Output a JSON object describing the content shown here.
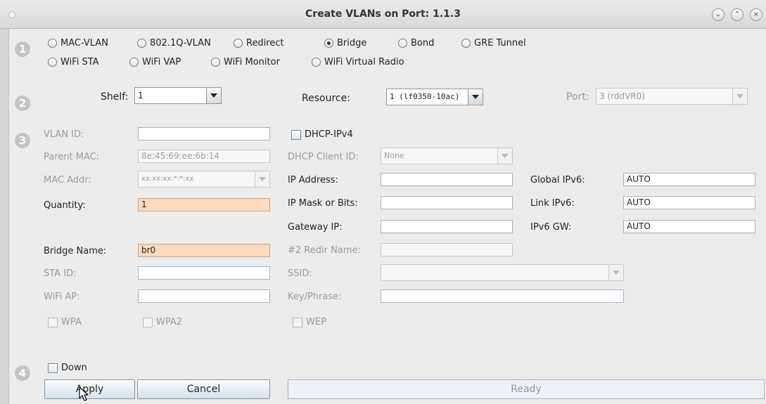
{
  "window": {
    "title": "Create VLANs on Port: 1.1.3"
  },
  "steps": [
    "1",
    "2",
    "3",
    "4"
  ],
  "vlan_types": {
    "row1": [
      {
        "label": "MAC-VLAN",
        "selected": false
      },
      {
        "label": "802.1Q-VLAN",
        "selected": false
      },
      {
        "label": "Redirect",
        "selected": false
      },
      {
        "label": "Bridge",
        "selected": true
      },
      {
        "label": "Bond",
        "selected": false
      },
      {
        "label": "GRE Tunnel",
        "selected": false
      }
    ],
    "row2": [
      {
        "label": "WiFi STA",
        "selected": false
      },
      {
        "label": "WiFi VAP",
        "selected": false
      },
      {
        "label": "WiFi Monitor",
        "selected": false
      },
      {
        "label": "WiFi Virtual Radio",
        "selected": false
      }
    ]
  },
  "location": {
    "shelf_label": "Shelf:",
    "shelf_value": "1",
    "resource_label": "Resource:",
    "resource_value": "1 (lf0350-10ac)",
    "port_label": "Port:",
    "port_value": "3 (rddVR0)"
  },
  "config": {
    "vlan_id_label": "VLAN ID:",
    "vlan_id_value": "",
    "parent_mac_label": "Parent MAC:",
    "parent_mac_value": "8e:45:69:ee:6b:14",
    "mac_addr_label": "MAC Addr:",
    "mac_addr_value": "xx:xx:xx:*:*:xx",
    "quantity_label": "Quantity:",
    "quantity_value": "1",
    "bridge_name_label": "Bridge Name:",
    "bridge_name_value": "br0",
    "sta_id_label": "STA ID:",
    "sta_id_value": "",
    "wifi_ap_label": "WiFi AP:",
    "wifi_ap_value": "",
    "wpa_label": "WPA",
    "wpa2_label": "WPA2",
    "dhcp_ipv4_label": "DHCP-IPv4",
    "dhcp_client_id_label": "DHCP Client ID:",
    "dhcp_client_id_value": "None",
    "ip_address_label": "IP Address:",
    "ip_address_value": "",
    "ip_mask_label": "IP Mask or Bits:",
    "ip_mask_value": "",
    "gateway_ip_label": "Gateway IP:",
    "gateway_ip_value": "",
    "redir_name_label": "#2 Redir Name:",
    "redir_name_value": "",
    "ssid_label": "SSID:",
    "ssid_value": "",
    "key_phrase_label": "Key/Phrase:",
    "key_phrase_value": "",
    "wep_label": "WEP",
    "global_ipv6_label": "Global IPv6:",
    "global_ipv6_value": "AUTO",
    "link_ipv6_label": "Link IPv6:",
    "link_ipv6_value": "AUTO",
    "ipv6_gw_label": "IPv6 GW:",
    "ipv6_gw_value": "AUTO"
  },
  "footer": {
    "down_label": "Down",
    "apply_label": "Apply",
    "cancel_label": "Cancel",
    "status": "Ready"
  }
}
